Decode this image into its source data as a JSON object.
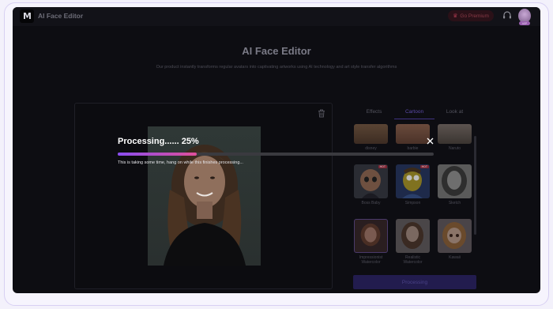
{
  "app": {
    "logo_text": "M",
    "name": "AI Face Editor"
  },
  "topbar": {
    "premium_label": "Go Premium",
    "avatar_badge": "VIP"
  },
  "page": {
    "title": "AI Face Editor",
    "subtitle": "Our product instantly transforms regular avatars into captivating artworks using AI technology and art style transfer algorithms"
  },
  "tabs": [
    {
      "label": "Effects",
      "active": false
    },
    {
      "label": "Cartoon",
      "active": true
    },
    {
      "label": "Look at",
      "active": false
    }
  ],
  "styles": [
    {
      "label": "disney",
      "hot": false
    },
    {
      "label": "barbie",
      "hot": false
    },
    {
      "label": "Naruto",
      "hot": false
    },
    {
      "label": "Boss Baby",
      "hot": true
    },
    {
      "label": "Simpson",
      "hot": true
    },
    {
      "label": "Sketch",
      "hot": false
    },
    {
      "label": "Impressionist Watercolor",
      "hot": false
    },
    {
      "label": "Realistic Watercolor",
      "hot": false
    },
    {
      "label": "Kawaii",
      "hot": false
    }
  ],
  "hot_badge_label": "HOT",
  "action_button": {
    "label": "Processing"
  },
  "processing": {
    "title": "Processing...... 25%",
    "progress": 0.25,
    "message": "This is taking some time, hang on while this finishes processing..."
  },
  "colors": {
    "accent": "#5a4aa8",
    "progress_start": "#8a4df0",
    "progress_end": "#e04f9a",
    "premium": "#a0364a"
  },
  "icons": {
    "logo": "logo-mark",
    "premium": "crown-icon",
    "support": "headset-icon",
    "trash": "trash-icon",
    "close": "close-icon"
  }
}
